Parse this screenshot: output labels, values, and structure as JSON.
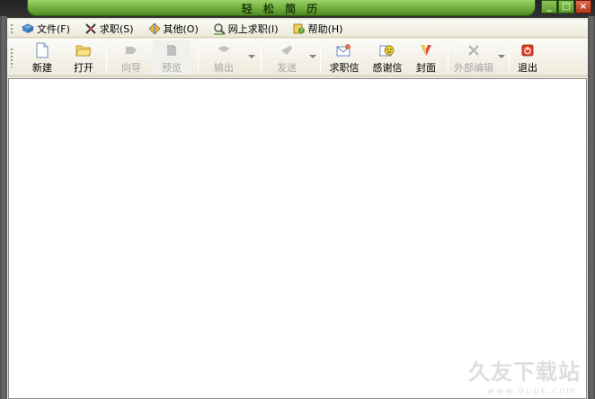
{
  "window": {
    "title": "轻 松 简 历",
    "controls": {
      "minimize": "_",
      "maximize": "□",
      "close": "×"
    }
  },
  "menu": [
    {
      "label": "文件(F)",
      "icon": "file-menu-icon"
    },
    {
      "label": "求职(S)",
      "icon": "job-search-icon"
    },
    {
      "label": "其他(O)",
      "icon": "other-icon"
    },
    {
      "label": "网上求职(I)",
      "icon": "online-job-icon"
    },
    {
      "label": "帮助(H)",
      "icon": "help-icon"
    }
  ],
  "toolbar": [
    {
      "label": "新建",
      "icon": "new-doc-icon",
      "enabled": true
    },
    {
      "label": "打开",
      "icon": "open-folder-icon",
      "enabled": true
    },
    {
      "label": "向导",
      "icon": "wizard-icon",
      "enabled": false
    },
    {
      "label": "预览",
      "icon": "preview-icon",
      "enabled": false
    },
    {
      "label": "输出",
      "icon": "export-icon",
      "enabled": false
    },
    {
      "label": "发送",
      "icon": "send-icon",
      "enabled": false
    },
    {
      "label": "求职信",
      "icon": "cover-letter-icon",
      "enabled": true
    },
    {
      "label": "感谢信",
      "icon": "thank-you-letter-icon",
      "enabled": true
    },
    {
      "label": "封面",
      "icon": "cover-page-icon",
      "enabled": true
    },
    {
      "label": "外部编辑",
      "icon": "external-edit-icon",
      "enabled": false
    },
    {
      "label": "退出",
      "icon": "exit-icon",
      "enabled": true
    }
  ],
  "colors": {
    "title_green": "#6fae3a",
    "toolbar_bg": "#ece9d8",
    "content_bg": "#ffffff"
  },
  "watermark": {
    "text": "久友下载站",
    "sub": "www.9upk.com"
  }
}
